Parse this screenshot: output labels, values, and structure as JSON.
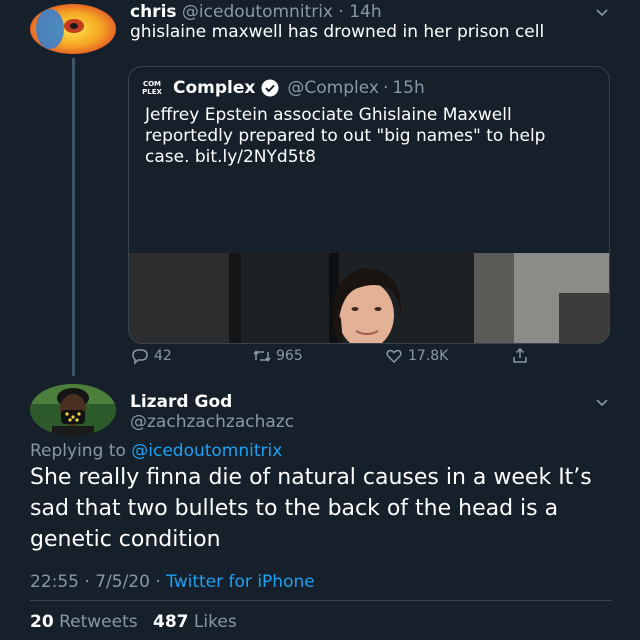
{
  "parent": {
    "display_name": "chris",
    "handle": "@icedoutomnitrix",
    "separator": "·",
    "time": "14h",
    "text": "ghislaine maxwell has drowned in her prison cell",
    "more_icon": "chevron-down-icon"
  },
  "quote": {
    "logo_line1": "COM",
    "logo_line2": "PLEX",
    "display_name": "Complex",
    "verified_icon": "verified-badge-icon",
    "handle": "@Complex",
    "separator": "·",
    "time": "15h",
    "text": "Jeffrey Epstein associate Ghislaine Maxwell reportedly prepared to out \"big names\" to help case. bit.ly/2NYd5t8"
  },
  "actions": {
    "replies": "42",
    "retweets": "965",
    "likes": "17.8K"
  },
  "reply": {
    "display_name": "Lizard God",
    "handle": "@zachzachzachazc",
    "replying_prefix": "Replying to",
    "replying_to": "@icedoutomnitrix",
    "text": "She really finna die of natural causes in a week It’s sad that two bullets to the back of the head is a genetic condition",
    "time": "22:55",
    "separator1": "·",
    "date": "7/5/20",
    "separator2": "·",
    "source": "Twitter for iPhone",
    "retweets_count": "20",
    "retweets_label": "Retweets",
    "likes_count": "487",
    "likes_label": "Likes"
  },
  "colors": {
    "background": "#15202b",
    "secondary_text": "#8899a6",
    "link": "#1da1f2",
    "border": "#38444d"
  }
}
